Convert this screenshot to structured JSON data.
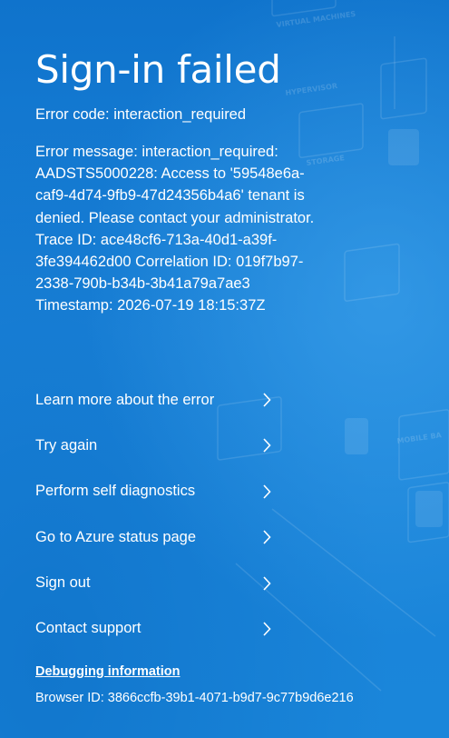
{
  "page": {
    "title": "Sign-in failed",
    "error_code": "Error code: interaction_required",
    "error_message": "Error message: interaction_required: AADSTS5000228: Access to '59548e6a-caf9-4d74-9fb9-47d24356b4a6' tenant is denied. Please contact your administrator. Trace ID: ace48cf6-713a-40d1-a39f-3fe394462d00 Correlation ID: 019f7b97-2338-790b-b34b-3b41a79a7ae3 Timestamp: 2026-07-19 18:15:37Z"
  },
  "actions": [
    {
      "label": "Learn more about the error",
      "icon": "chevron-right-icon"
    },
    {
      "label": "Try again",
      "icon": "chevron-right-icon"
    },
    {
      "label": "Perform self diagnostics",
      "icon": "chevron-right-icon"
    },
    {
      "label": "Go to Azure status page",
      "icon": "chevron-right-icon"
    },
    {
      "label": "Sign out",
      "icon": "chevron-right-icon"
    },
    {
      "label": "Contact support",
      "icon": "chevron-right-icon"
    }
  ],
  "debug": {
    "link_label": "Debugging information",
    "browser_id": "Browser ID: 3866ccfb-39b1-4071-b9d7-9c77b9d6e216"
  },
  "background": {
    "labels": [
      "VIRTUAL MACHINES",
      "HYPERVISOR",
      "STORAGE",
      "MOBILE BA"
    ]
  },
  "colors": {
    "background": "#1177cf",
    "text": "#ffffff"
  }
}
